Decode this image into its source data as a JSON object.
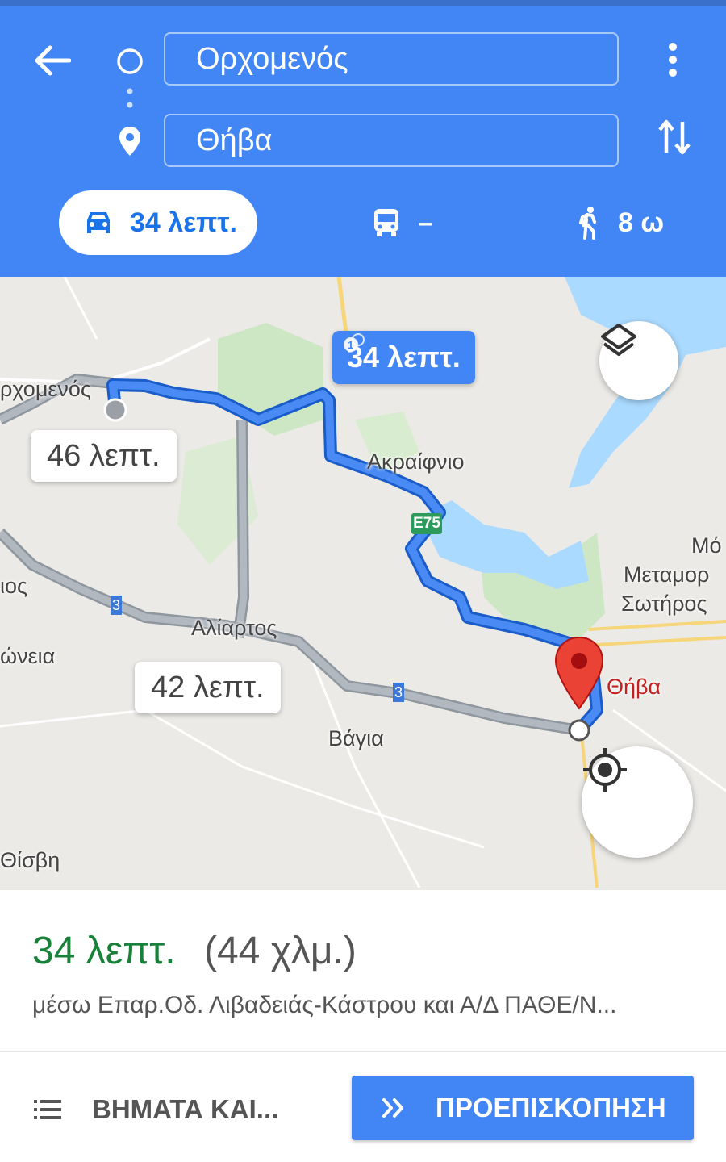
{
  "search": {
    "origin": "Ορχομενός",
    "destination": "Θήβα"
  },
  "icons": {
    "back": "arrow-left-icon",
    "origin_marker": "circle-icon",
    "destination_marker": "place-icon",
    "menu": "more-vert-icon",
    "swap": "swap-vert-icon",
    "car": "car-icon",
    "transit": "bus-icon",
    "walk": "walk-icon",
    "layers": "layers-icon",
    "location": "my-location-icon",
    "list": "list-icon",
    "preview": "double-chevron-right-icon"
  },
  "modes": {
    "car": "34 λεπτ.",
    "transit": "–",
    "walk": "8 ω"
  },
  "map": {
    "main_route_label": "34 λεπτ.",
    "alt_route_1": "46 λεπτ.",
    "alt_route_2": "42 λεπτ.",
    "places": {
      "orchomenos": "ρχομενός",
      "akraifnio": "Ακραίφνιο",
      "aliartos": "Αλίαρτος",
      "vagia": "Βάγια",
      "thiva": "Θήβα",
      "metamorfosi_1": "Μό",
      "metamorfosi_2": "Μεταμορ",
      "metamorfosi_3": "Σωτήρος",
      "ios": "ιος",
      "oneia": "ώνεια",
      "thisvi": "Θίσβη",
      "e75": "E75",
      "road3": "3"
    }
  },
  "summary": {
    "time": "34 λεπτ.",
    "distance": "(44 χλμ.)",
    "via": "μέσω Επαρ.Οδ. Λιβαδειάς-Κάστρου και Α/Δ ΠΑΘΕ/Ν..."
  },
  "actions": {
    "steps": "ΒΗΜΑΤΑ ΚΑΙ...",
    "preview": "ΠΡΟΕΠΙΣΚΟΠΗΣΗ"
  },
  "colors": {
    "header": "#4285f4",
    "route": "#4285f4",
    "alt_route": "#a7aeb6",
    "time_green": "#188038",
    "pin_red": "#ea4335"
  }
}
